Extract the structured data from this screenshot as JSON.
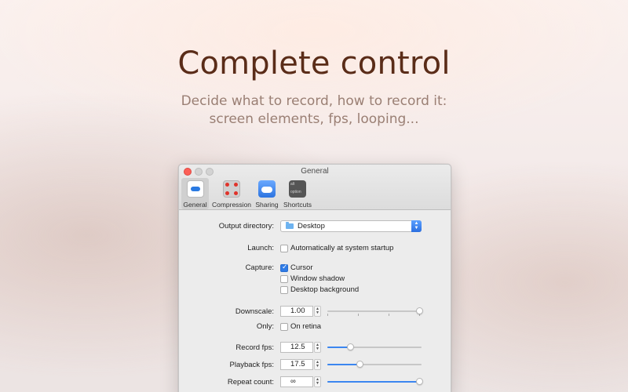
{
  "hero": {
    "title": "Complete control",
    "subtitle_line1": "Decide what to record, how to record it:",
    "subtitle_line2": "screen elements, fps, looping..."
  },
  "window": {
    "title": "General",
    "tabs": [
      {
        "label": "General",
        "icon": "toggle-icon",
        "selected": true
      },
      {
        "label": "Compression",
        "icon": "compression-icon",
        "selected": false
      },
      {
        "label": "Sharing",
        "icon": "cloud-icon",
        "selected": false
      },
      {
        "label": "Shortcuts",
        "icon": "keyboard-icon",
        "selected": false
      }
    ],
    "shortcuts_icon_text": {
      "top": "alt",
      "bottom": "option"
    }
  },
  "settings": {
    "output_directory": {
      "label": "Output directory:",
      "value": "Desktop"
    },
    "launch": {
      "label": "Launch:",
      "option": "Automatically at system startup",
      "checked": false
    },
    "capture": {
      "label": "Capture:",
      "options": [
        {
          "label": "Cursor",
          "checked": true
        },
        {
          "label": "Window shadow",
          "checked": false
        },
        {
          "label": "Desktop background",
          "checked": false
        }
      ]
    },
    "downscale": {
      "label": "Downscale:",
      "value": "1.00",
      "slider_fraction": 1.0
    },
    "only": {
      "label": "Only:",
      "option": "On retina",
      "checked": false
    },
    "record_fps": {
      "label": "Record fps:",
      "value": "12.5",
      "slider_fraction": 0.25
    },
    "playback_fps": {
      "label": "Playback fps:",
      "value": "17.5",
      "slider_fraction": 0.35
    },
    "repeat_count": {
      "label": "Repeat count:",
      "value": "∞",
      "slider_fraction": 1.0
    }
  },
  "colors": {
    "accent": "#2f7be6",
    "title_color": "#5a2c18",
    "subtitle_color": "#9a7f74",
    "close_button": "#fc5f57"
  }
}
